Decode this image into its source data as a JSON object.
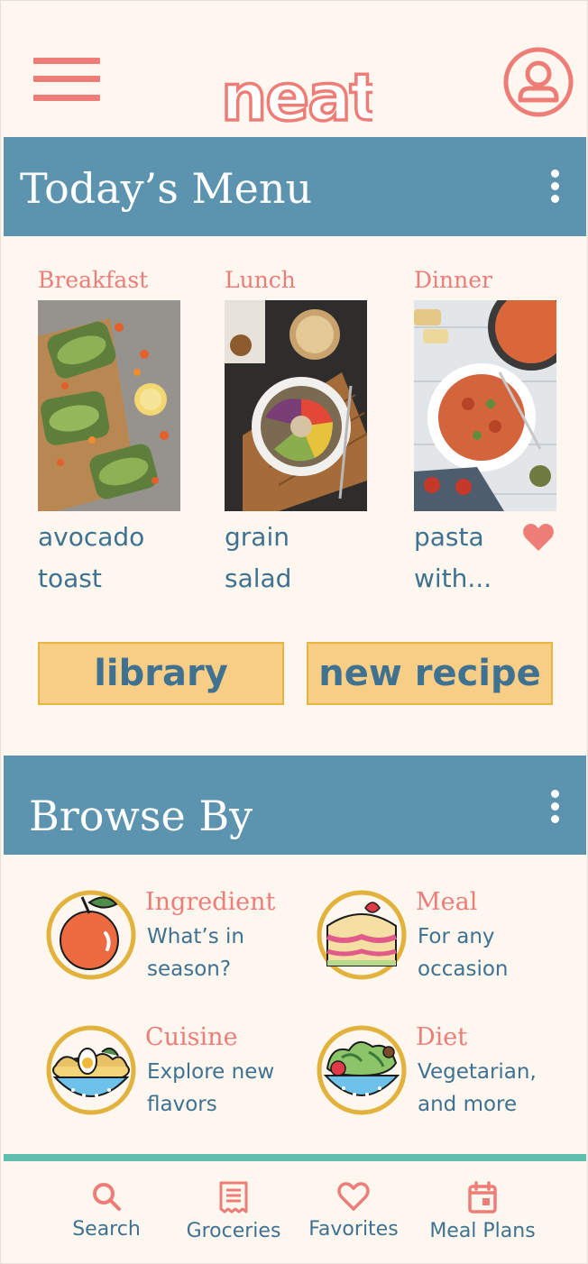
{
  "app": {
    "logo_text": "neat"
  },
  "colors": {
    "accent": "#EE7C77",
    "header_blue": "#5C93AF",
    "text_blue": "#3F7191",
    "button_yellow": "#F8CD85",
    "nav_line": "#5FBFAE",
    "background": "#FDF7EF"
  },
  "header": {
    "menu_icon": "hamburger-menu-icon",
    "profile_icon": "user-profile-icon"
  },
  "todays_menu": {
    "title": "Today’s Menu",
    "meals": [
      {
        "label": "Breakfast",
        "name_line1": "avocado",
        "name_line2": "toast",
        "favorite": false
      },
      {
        "label": "Lunch",
        "name_line1": "grain",
        "name_line2": "salad",
        "favorite": false
      },
      {
        "label": "Dinner",
        "name_line1": "pasta",
        "name_line2": "with...",
        "favorite": true
      }
    ]
  },
  "actions": {
    "library_label": "library",
    "new_recipe_label": "new recipe"
  },
  "browse_by": {
    "title": "Browse By",
    "items": [
      {
        "title": "Ingredient",
        "desc_line1": "What’s in",
        "desc_line2": "season?",
        "icon": "apple-icon"
      },
      {
        "title": "Meal",
        "desc_line1": "For any",
        "desc_line2": "occasion",
        "icon": "cake-icon"
      },
      {
        "title": "Cuisine",
        "desc_line1": "Explore new",
        "desc_line2": "flavors",
        "icon": "noodle-bowl-icon"
      },
      {
        "title": "Diet",
        "desc_line1": "Vegetarian,",
        "desc_line2": "and more",
        "icon": "salad-bowl-icon"
      }
    ]
  },
  "bottom_nav": {
    "tabs": [
      {
        "label": "Search",
        "icon": "search-icon"
      },
      {
        "label": "Groceries",
        "icon": "receipt-icon"
      },
      {
        "label": "Favorites",
        "icon": "heart-icon"
      },
      {
        "label": "Meal Plans",
        "icon": "calendar-icon"
      }
    ]
  }
}
